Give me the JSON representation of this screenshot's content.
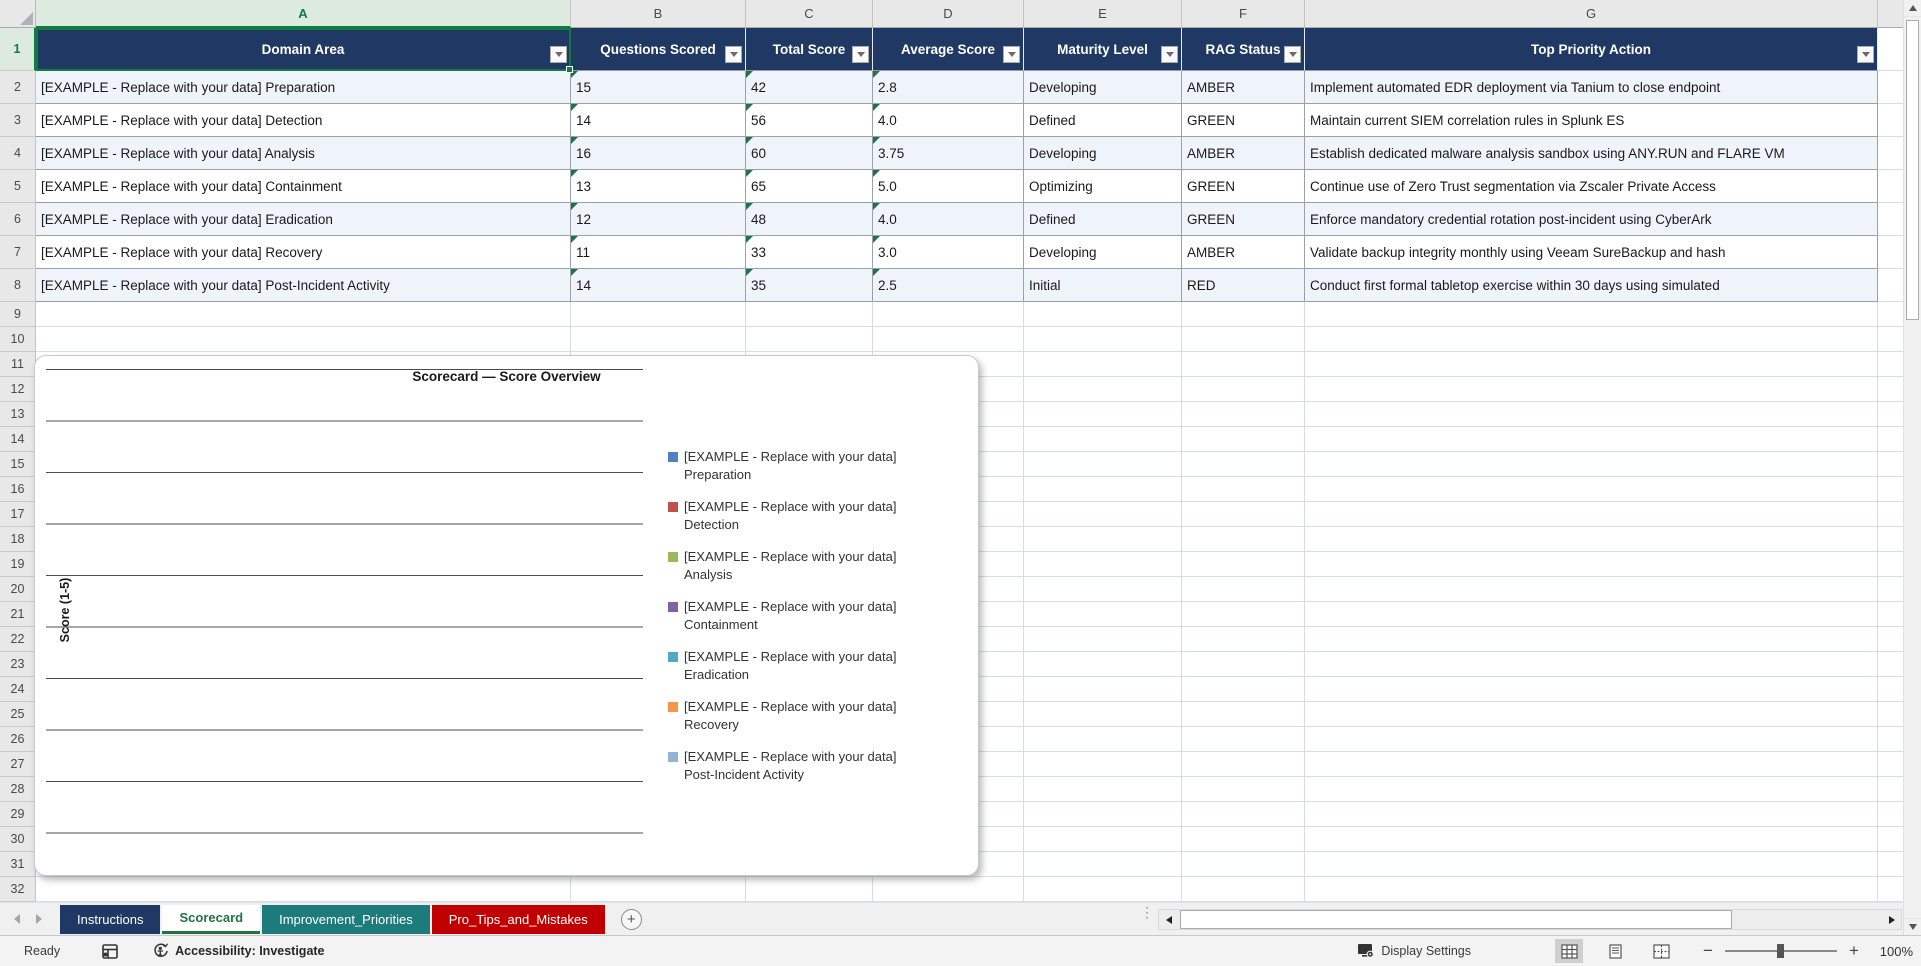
{
  "grid": {
    "column_letters": [
      "A",
      "B",
      "C",
      "D",
      "E",
      "F",
      "G"
    ],
    "row_count": 32,
    "selected_column": "A",
    "selected_row": "1"
  },
  "table": {
    "headers": [
      "Domain Area",
      "Questions Scored",
      "Total Score",
      "Average Score",
      "Maturity Level",
      "RAG Status",
      "Top Priority Action"
    ],
    "rows": [
      [
        "[EXAMPLE - Replace with your data] Preparation",
        "15",
        "42",
        "2.8",
        "Developing",
        "AMBER",
        "Implement automated EDR deployment via Tanium to close endpoint"
      ],
      [
        "[EXAMPLE - Replace with your data] Detection",
        "14",
        "56",
        "4.0",
        "Defined",
        "GREEN",
        "Maintain current SIEM correlation rules in Splunk ES"
      ],
      [
        "[EXAMPLE - Replace with your data] Analysis",
        "16",
        "60",
        "3.75",
        "Developing",
        "AMBER",
        "Establish dedicated malware analysis sandbox using ANY.RUN and FLARE VM"
      ],
      [
        "[EXAMPLE - Replace with your data] Containment",
        "13",
        "65",
        "5.0",
        "Optimizing",
        "GREEN",
        "Continue use of Zero Trust segmentation via Zscaler Private Access"
      ],
      [
        "[EXAMPLE - Replace with your data] Eradication",
        "12",
        "48",
        "4.0",
        "Defined",
        "GREEN",
        "Enforce mandatory credential rotation post-incident using CyberArk"
      ],
      [
        "[EXAMPLE - Replace with your data] Recovery",
        "11",
        "33",
        "3.0",
        "Developing",
        "AMBER",
        "Validate backup integrity monthly using Veeam SureBackup and hash"
      ],
      [
        "[EXAMPLE - Replace with your data] Post-Incident Activity",
        "14",
        "35",
        "2.5",
        "Initial",
        "RED",
        "Conduct first formal tabletop exercise within 30 days using simulated"
      ]
    ]
  },
  "chart_data": {
    "type": "bar",
    "title": "Scorecard — Score Overview",
    "ylabel": "Score (1-5)",
    "series": [
      {
        "name": "[EXAMPLE - Replace with your data] Preparation",
        "color": "#4F81BD"
      },
      {
        "name": "[EXAMPLE - Replace with your data] Detection",
        "color": "#C0504D"
      },
      {
        "name": "[EXAMPLE - Replace with your data] Analysis",
        "color": "#9BBB59"
      },
      {
        "name": "[EXAMPLE - Replace with your data] Containment",
        "color": "#8064A2"
      },
      {
        "name": "[EXAMPLE - Replace with your data] Eradication",
        "color": "#4BACC6"
      },
      {
        "name": "[EXAMPLE - Replace with your data] Recovery",
        "color": "#F79646"
      },
      {
        "name": "[EXAMPLE - Replace with your data] Post-Incident Activity",
        "color": "#95B3D7"
      }
    ],
    "values_visible": false,
    "note": "Plot area shows only horizontal gridlines; no bars are drawn in the screenshot.",
    "gridline_count": 10,
    "legend_position": "right"
  },
  "sheet_tabs": {
    "tabs": [
      {
        "label": "Instructions",
        "bg": "#1F3864",
        "fg": "#FFFFFF",
        "active": false
      },
      {
        "label": "Scorecard",
        "bg": "#FFFFFF",
        "fg": "#217346",
        "active": true
      },
      {
        "label": "Improvement_Priorities",
        "bg": "#1E7B7B",
        "fg": "#FFFFFF",
        "active": false
      },
      {
        "label": "Pro_Tips_and_Mistakes",
        "bg": "#C00000",
        "fg": "#FFFFFF",
        "active": false
      }
    ],
    "add_sheet_label": "+"
  },
  "status_bar": {
    "ready": "Ready",
    "accessibility": "Accessibility: Investigate",
    "display_settings": "Display Settings",
    "zoom_level": "100%"
  },
  "colors": {
    "table_header_bg": "#1F3864",
    "selection_green": "#107C41",
    "banded_row": "#EFF3FA",
    "error_triangle": "#217346"
  }
}
